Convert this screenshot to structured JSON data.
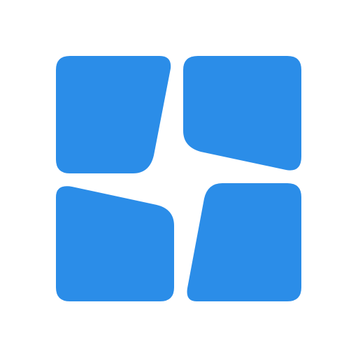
{
  "logo": {
    "icon": "four-panel-window-icon",
    "color": "#2b8de8",
    "background": "#ffffff"
  }
}
